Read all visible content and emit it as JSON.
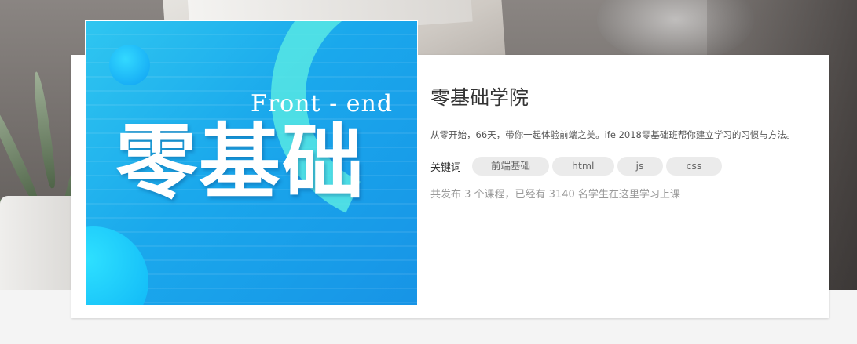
{
  "course": {
    "title": "零基础学院",
    "description": "从零开始，66天，带你一起体验前端之美。ife 2018零基础班帮你建立学习的习惯与方法。",
    "keywords_label": "关键词",
    "keywords": [
      "前端基础",
      "html",
      "js",
      "css"
    ],
    "stats": "共发布 3 个课程，已经有 3140 名学生在这里学习上课"
  },
  "banner": {
    "subtitle": "Front - end",
    "title": "零基础"
  },
  "colors": {
    "banner_start": "#2fc6f0",
    "banner_end": "#1794e6",
    "tag_bg": "#ebebeb",
    "page_bg": "#f4f4f4"
  }
}
